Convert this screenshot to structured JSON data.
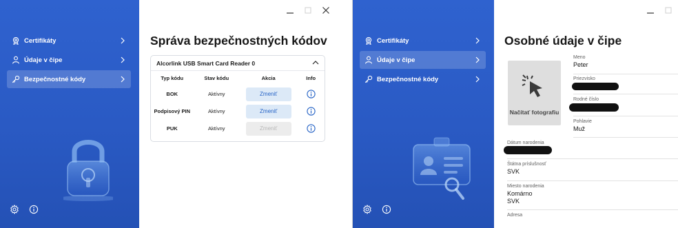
{
  "window1": {
    "sidebar": {
      "items": [
        {
          "label": "Certifikáty",
          "icon": "certificate-icon",
          "active": false
        },
        {
          "label": "Údaje v čipe",
          "icon": "person-icon",
          "active": false
        },
        {
          "label": "Bezpečnostné kódy",
          "icon": "key-icon",
          "active": true
        }
      ],
      "bottom_icons": [
        "settings-icon",
        "info-icon"
      ],
      "illustration": "padlock-illustration"
    },
    "title": "Správa bezpečnostných kódov",
    "reader_card": {
      "reader_name": "Alcorlink USB Smart Card Reader 0",
      "columns": [
        "Typ kódu",
        "Stav kódu",
        "Akcia",
        "Info"
      ],
      "rows": [
        {
          "type": "BOK",
          "status": "Aktívny",
          "action": "Zmeniť",
          "enabled": true
        },
        {
          "type": "Podpisový PIN",
          "status": "Aktívny",
          "action": "Zmeniť",
          "enabled": true
        },
        {
          "type": "PUK",
          "status": "Aktívny",
          "action": "Zmeniť",
          "enabled": false
        }
      ]
    }
  },
  "window2": {
    "sidebar": {
      "items": [
        {
          "label": "Certifikáty",
          "icon": "certificate-icon",
          "active": false
        },
        {
          "label": "Údaje v čipe",
          "icon": "person-icon",
          "active": true
        },
        {
          "label": "Bezpečnostné kódy",
          "icon": "key-icon",
          "active": false
        }
      ],
      "bottom_icons": [
        "settings-icon",
        "info-icon"
      ],
      "illustration": "id-card-illustration"
    },
    "title": "Osobné údaje v čipe",
    "photo_caption": "Načítať fotografiu",
    "fields": {
      "meno": {
        "label": "Meno",
        "value": "Peter"
      },
      "priezvisko": {
        "label": "Priezvisko",
        "value": ""
      },
      "rodne_cislo": {
        "label": "Rodné číslo",
        "value": ""
      },
      "pohlavie": {
        "label": "Pohlavie",
        "value": "Muž"
      },
      "datum_narodenia": {
        "label": "Dátum narodenia",
        "value": ""
      },
      "statna_prislusnost": {
        "label": "Štátna príslušnosť",
        "value": "SVK"
      },
      "miesto_narodenia": {
        "label": "Miesto narodenia",
        "value_line1": "Komárno",
        "value_line2": "SVK"
      },
      "adresa": {
        "label": "Adresa",
        "value": ""
      }
    }
  },
  "colors": {
    "sidebar_blue": "#2a5ac4",
    "accent": "#2462c5",
    "button_bg": "#dce9f7",
    "disabled_bg": "#ececec"
  }
}
